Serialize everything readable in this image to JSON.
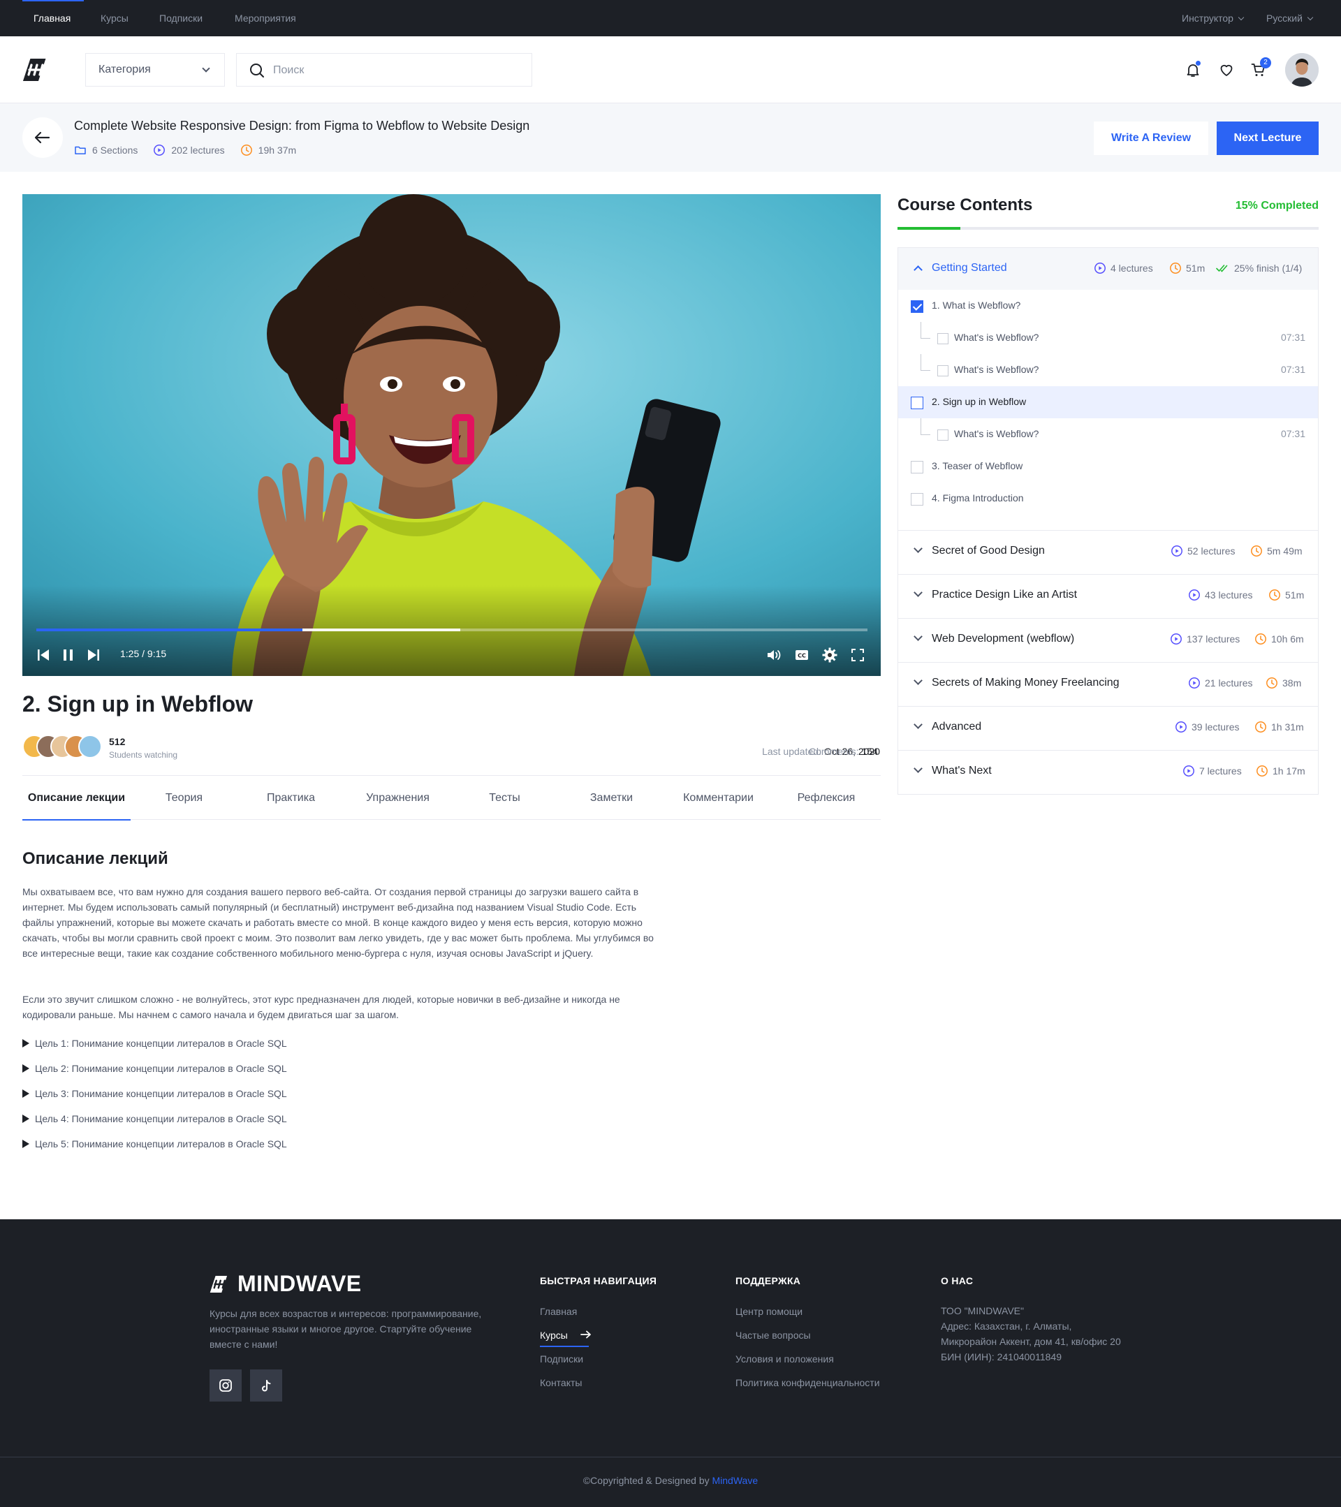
{
  "topnav": {
    "items": [
      "Главная",
      "Курсы",
      "Подписки",
      "Мероприятия"
    ],
    "instructor": "Инструктор",
    "language": "Русский"
  },
  "header": {
    "category": "Категория",
    "search_placeholder": "Поиск",
    "cart_count": "2"
  },
  "course": {
    "title": "Complete Website Responsive Design: from Figma to Webflow to Website Design",
    "sections": "6 Sections",
    "lectures": "202 lectures",
    "duration": "19h 37m",
    "review_button": "Write A Review",
    "next_button": "Next Lecture"
  },
  "player": {
    "time": "1:25 / 9:15",
    "progress": 0.32,
    "buffered": 0.51
  },
  "lecture": {
    "title": "2. Sign up in Webflow",
    "watchers_count": "512",
    "watchers_label": "Students watching",
    "last_updated_label": "Last updated:",
    "last_updated": "Oct 26, 2020",
    "comments_label": "Comments:",
    "comments": "154"
  },
  "tabs": [
    "Описание лекции",
    "Теория",
    "Практика",
    "Упражнения",
    "Тесты",
    "Заметки",
    "Комментарии",
    "Рефлексия"
  ],
  "description": {
    "title": "Описание лекций",
    "p1": "Мы охватываем все, что вам нужно для создания вашего первого веб-сайта. От создания первой страницы до загрузки вашего сайта в интернет. Мы будем использовать самый популярный (и бесплатный) инструмент веб-дизайна под названием Visual Studio Code. Есть файлы упражнений, которые вы можете скачать и работать вместе со мной. В конце каждого видео у меня есть версия, которую можно скачать, чтобы вы могли сравнить свой проект с моим. Это позволит вам легко увидеть, где у вас может быть проблема. Мы углубимся во все интересные вещи, такие как создание собственного мобильного меню-бургера с нуля, изучая основы JavaScript и jQuery.",
    "p2": "Если это звучит слишком сложно - не волнуйтесь, этот курс предназначен для людей, которые новички в веб-дизайне и никогда не кодировали раньше. Мы начнем с самого начала и будем двигаться шаг за шагом.",
    "goals": [
      "Цель 1: Понимание концепции литералов в Oracle SQL",
      "Цель 2: Понимание концепции литералов в Oracle SQL",
      "Цель 3: Понимание концепции литералов в Oracle SQL",
      "Цель 4: Понимание концепции литералов в Oracle SQL",
      "Цель 5: Понимание концепции литералов в Oracle SQL"
    ]
  },
  "contents": {
    "title": "Course Contents",
    "completed": "15% Completed",
    "completed_fraction": 0.15,
    "open_section": {
      "name": "Getting Started",
      "lectures": "4 lectures",
      "duration": "51m",
      "finish": "25% finish (1/4)",
      "lessons": [
        {
          "name": "1. What is Webflow?",
          "checked": true
        },
        {
          "name": "What's is Webflow?",
          "duration": "07:31",
          "sub": true
        },
        {
          "name": "What's is Webflow?",
          "duration": "07:31",
          "sub": true
        },
        {
          "name": "2. Sign up in Webflow",
          "active": true
        },
        {
          "name": "What's is Webflow?",
          "duration": "07:31",
          "sub": true
        },
        {
          "name": "3. Teaser of Webflow"
        },
        {
          "name": "4. Figma Introduction"
        }
      ]
    },
    "sections": [
      {
        "name": "Secret of Good Design",
        "lectures": "52 lectures",
        "duration": "5m 49m"
      },
      {
        "name": "Practice Design Like an Artist",
        "lectures": "43 lectures",
        "duration": "51m"
      },
      {
        "name": "Web Development (webflow)",
        "lectures": "137 lectures",
        "duration": "10h 6m"
      },
      {
        "name": "Secrets of Making Money Freelancing",
        "lectures": "21 lectures",
        "duration": "38m"
      },
      {
        "name": "Advanced",
        "lectures": "39 lectures",
        "duration": "1h 31m"
      },
      {
        "name": "What's Next",
        "lectures": "7 lectures",
        "duration": "1h 17m"
      }
    ]
  },
  "footer": {
    "brand": "MINDWAVE",
    "description": "Курсы для всех возрастов и интересов: программирование, иностранные языки и многое другое. Стартуйте обучение вместе с нами!",
    "nav_title": "БЫСТРАЯ НАВИГАЦИЯ",
    "nav_links": [
      "Главная",
      "Курсы",
      "Подписки",
      "Контакты"
    ],
    "support_title": "ПОДДЕРЖКА",
    "support_links": [
      "Центр помощи",
      "Частые вопросы",
      "Условия и положения",
      "Политика конфиденциальности"
    ],
    "about_title": "О НАС",
    "about_lines": [
      "ТОО \"MINDWAVE\"",
      "Адрес: Казахстан, г. Алматы,",
      "Микрорайон Аккент, дом 41, кв/офис 20",
      "БИН (ИИН): 241040011849"
    ],
    "copyright": "©Copyrighted & Designed by ",
    "copyright_brand": "MindWave"
  },
  "colors": {
    "primary": "#2c64f4",
    "success": "#23bd33",
    "warning": "#fd8e1f",
    "dark": "#1d2026"
  }
}
